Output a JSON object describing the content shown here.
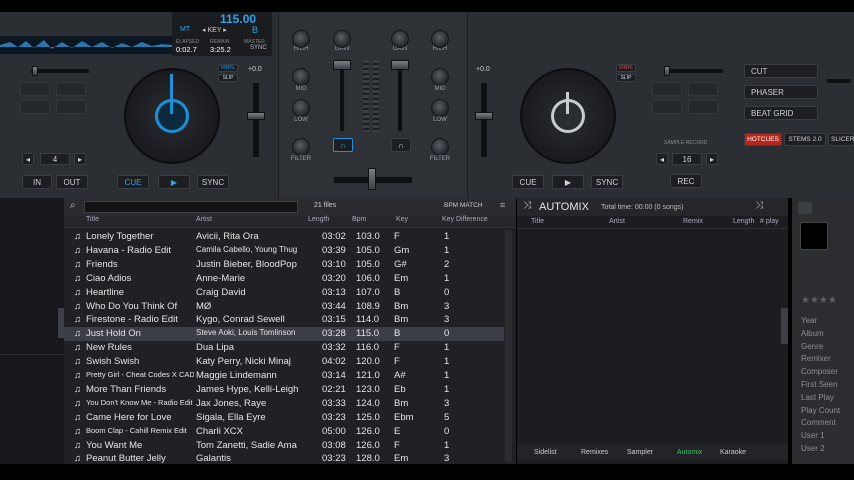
{
  "top_display": {
    "bpm": "115.00",
    "mt": "MT",
    "key_label": "◂ KEY ▸",
    "key_value": "B",
    "elapsed_label": "ELAPSED",
    "elapsed": "0:02.7",
    "remain_label": "REMAIN",
    "remain": "3:25.2",
    "master_label": "MASTER",
    "sync_label": "SYNC"
  },
  "mixer": {
    "high": "HIGH",
    "gain": "GAIN",
    "mid": "MID",
    "low": "LOW",
    "filter": "FILTER"
  },
  "deck_left": {
    "pitch": "+0.0",
    "vinyl": "VINYL",
    "slip": "SLIP",
    "loop_value": "4",
    "in": "IN",
    "out": "OUT",
    "cue": "CUE",
    "play": "▶",
    "sync": "SYNC"
  },
  "deck_right": {
    "pitch": "+0.0",
    "vinyl": "VINYL",
    "slip": "SLIP",
    "cue": "CUE",
    "play": "▶",
    "sync": "SYNC",
    "sample_record_label": "SAMPLE RECORD",
    "sample_value": "16",
    "rec": "REC",
    "fx": [
      "CUT",
      "PHASER",
      "BEAT GRID"
    ],
    "pad_tabs": [
      "HOTCUES",
      "STEMS 2.0",
      "SLICER"
    ]
  },
  "browser": {
    "search_placeholder": "",
    "files_count": "21 files",
    "bpm_match": "BPM MATCH",
    "columns": [
      "Title",
      "Artist",
      "Length",
      "Bpm",
      "Key",
      "Key Difference"
    ],
    "rows": [
      [
        "Lonely Together",
        "Avicii, Rita Ora",
        "03:02",
        "103.0",
        "F",
        "1"
      ],
      [
        "Havana - Radio Edit",
        "Camila Cabello, Young Thug",
        "03:39",
        "105.0",
        "Gm",
        "1"
      ],
      [
        "Friends",
        "Justin Bieber, BloodPop",
        "03:10",
        "105.0",
        "G#",
        "2"
      ],
      [
        "Ciao Adios",
        "Anne-Marie",
        "03:20",
        "106.0",
        "Em",
        "1"
      ],
      [
        "Heartline",
        "Craig David",
        "03:13",
        "107.0",
        "B",
        "0"
      ],
      [
        "Who Do You Think Of",
        "MØ",
        "03:44",
        "108.9",
        "Bm",
        "3"
      ],
      [
        "Firestone - Radio Edit",
        "Kygo, Conrad Sewell",
        "03:15",
        "114.0",
        "Bm",
        "3"
      ],
      [
        "Just Hold On",
        "Steve Aoki, Louis Tomlinson",
        "03:28",
        "115.0",
        "B",
        "0"
      ],
      [
        "New Rules",
        "Dua Lipa",
        "03:32",
        "116.0",
        "F",
        "1"
      ],
      [
        "Swish Swish",
        "Katy Perry, Nicki Minaj",
        "04:02",
        "120.0",
        "F",
        "1"
      ],
      [
        "Pretty Girl - Cheat Codes X CADE",
        "Maggie Lindemann",
        "03:14",
        "121.0",
        "A#",
        "1"
      ],
      [
        "More Than Friends",
        "James Hype, Kelli-Leigh",
        "02:21",
        "123.0",
        "Eb",
        "1"
      ],
      [
        "You Don't Know Me - Radio Edit",
        "Jax Jones, Raye",
        "03:33",
        "124.0",
        "Bm",
        "3"
      ],
      [
        "Came Here for Love",
        "Sigala, Ella Eyre",
        "03:23",
        "125.0",
        "Ebm",
        "5"
      ],
      [
        "Boom Clap - Cahill Remix Edit",
        "Charli XCX",
        "05:00",
        "126.0",
        "E",
        "0"
      ],
      [
        "You Want Me",
        "Tom Zanetti, Sadie Ama",
        "03:08",
        "126.0",
        "F",
        "1"
      ],
      [
        "Peanut Butter Jelly",
        "Galantis",
        "03:23",
        "128.0",
        "Em",
        "3"
      ]
    ],
    "selected_row": 7
  },
  "automix": {
    "title": "AUTOMIX",
    "total_time": "Total time: 00:00 (0 songs)",
    "columns": [
      "Title",
      "Artist",
      "Remix",
      "Length",
      "# play"
    ],
    "bottom_tabs": [
      "Sidelist",
      "Remixes",
      "Sampler",
      "Automix",
      "Karaoke"
    ]
  },
  "info_panel": {
    "labels": [
      "Year",
      "Album",
      "Genre",
      "Remixer",
      "Composer",
      "First Seen",
      "Last Play",
      "Play Count",
      "Comment",
      "User 1",
      "User 2"
    ]
  },
  "colors": {
    "accent_blue": "#1f8fd6",
    "hotcue_red": "#c0392b",
    "deck_bg": "#2b2e33"
  }
}
